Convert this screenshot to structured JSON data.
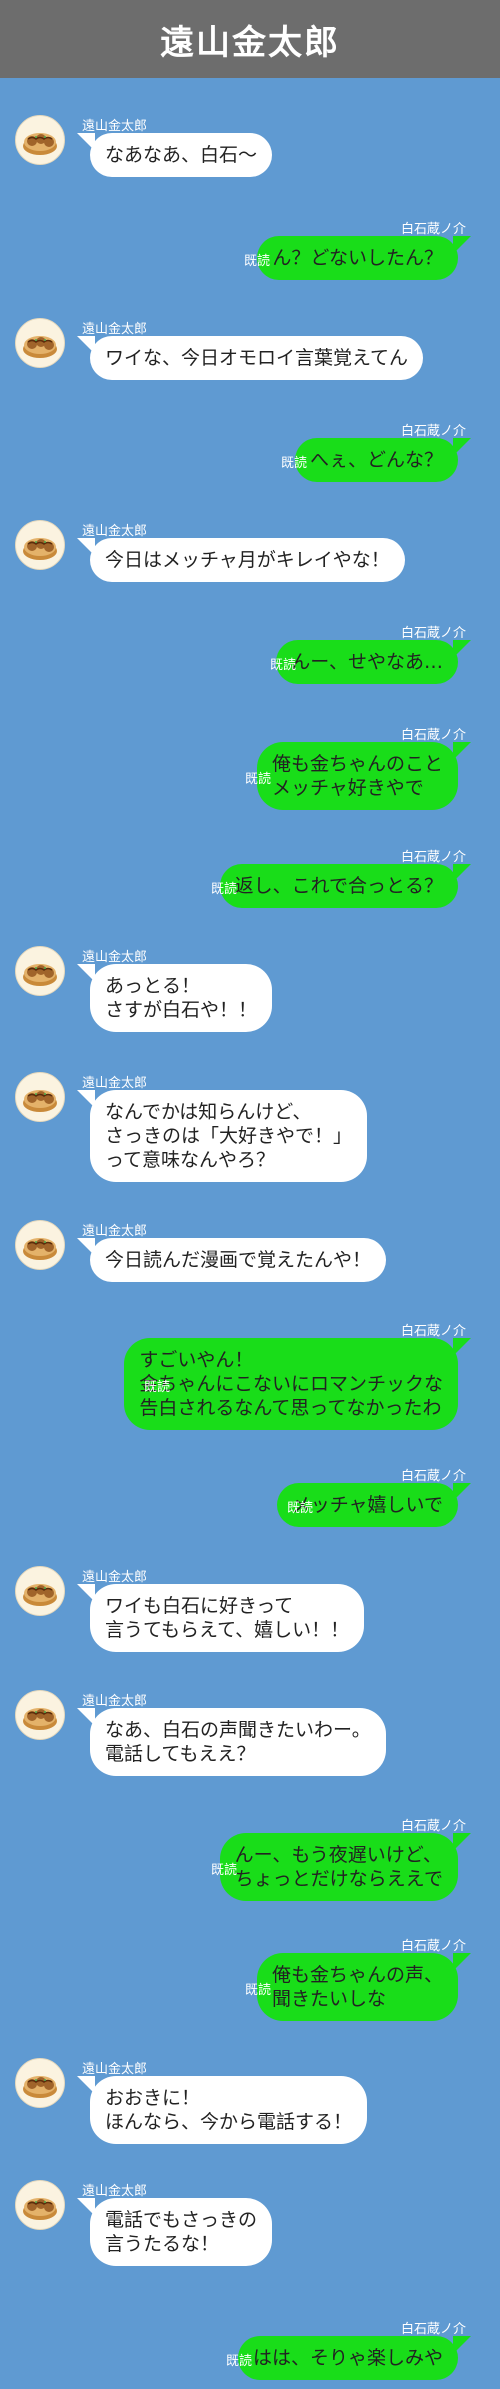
{
  "header": {
    "title": "遠山金太郎"
  },
  "messages": [
    {
      "side": "left",
      "name": "遠山金太郎",
      "text": "なあなあ、白石〜"
    },
    {
      "side": "right",
      "name": "白石蔵ノ介",
      "read": "既読",
      "text": "ん？どないしたん？"
    },
    {
      "side": "left",
      "name": "遠山金太郎",
      "text": "ワイな、今日オモロイ言葉覚えてん"
    },
    {
      "side": "right",
      "name": "白石蔵ノ介",
      "read": "既読",
      "text": "へぇ、どんな？"
    },
    {
      "side": "left",
      "name": "遠山金太郎",
      "text": "今日はメッチャ月がキレイやな！"
    },
    {
      "side": "right",
      "name": "白石蔵ノ介",
      "read": "既読",
      "text": "んー、せやなあ…"
    },
    {
      "side": "right",
      "name": "白石蔵ノ介",
      "read": "既読",
      "text": "俺も金ちゃんのこと\nメッチャ好きやで"
    },
    {
      "side": "right",
      "name": "白石蔵ノ介",
      "read": "既読",
      "text": "返し、これで合っとる？"
    },
    {
      "side": "left",
      "name": "遠山金太郎",
      "text": "あっとる！\nさすが白石や！！"
    },
    {
      "side": "left",
      "name": "遠山金太郎",
      "text": "なんでかは知らんけど、\nさっきのは「大好きやで！」\nって意味なんやろ？"
    },
    {
      "side": "left",
      "name": "遠山金太郎",
      "text": "今日読んだ漫画で覚えたんや！"
    },
    {
      "side": "right",
      "name": "白石蔵ノ介",
      "read": "既読",
      "text": "すごいやん！\n金ちゃんにこないにロマンチックな\n告白されるなんて思ってなかったわ"
    },
    {
      "side": "right",
      "name": "白石蔵ノ介",
      "read": "既読",
      "text": "メッチャ嬉しいで"
    },
    {
      "side": "left",
      "name": "遠山金太郎",
      "text": "ワイも白石に好きって\n言うてもらえて、嬉しい！！"
    },
    {
      "side": "left",
      "name": "遠山金太郎",
      "text": "なあ、白石の声聞きたいわー。\n電話してもええ？"
    },
    {
      "side": "right",
      "name": "白石蔵ノ介",
      "read": "既読",
      "text": "んー、もう夜遅いけど、\nちょっとだけならええで"
    },
    {
      "side": "right",
      "name": "白石蔵ノ介",
      "read": "既読",
      "text": "俺も金ちゃんの声、\n聞きたいしな"
    },
    {
      "side": "left",
      "name": "遠山金太郎",
      "text": "おおきに！\nほんなら、今から電話する！"
    },
    {
      "side": "left",
      "name": "遠山金太郎",
      "text": "電話でもさっきの\n言うたるな！"
    },
    {
      "side": "right",
      "name": "白石蔵ノ介",
      "read": "既読",
      "text": "はは、そりゃ楽しみや"
    }
  ]
}
